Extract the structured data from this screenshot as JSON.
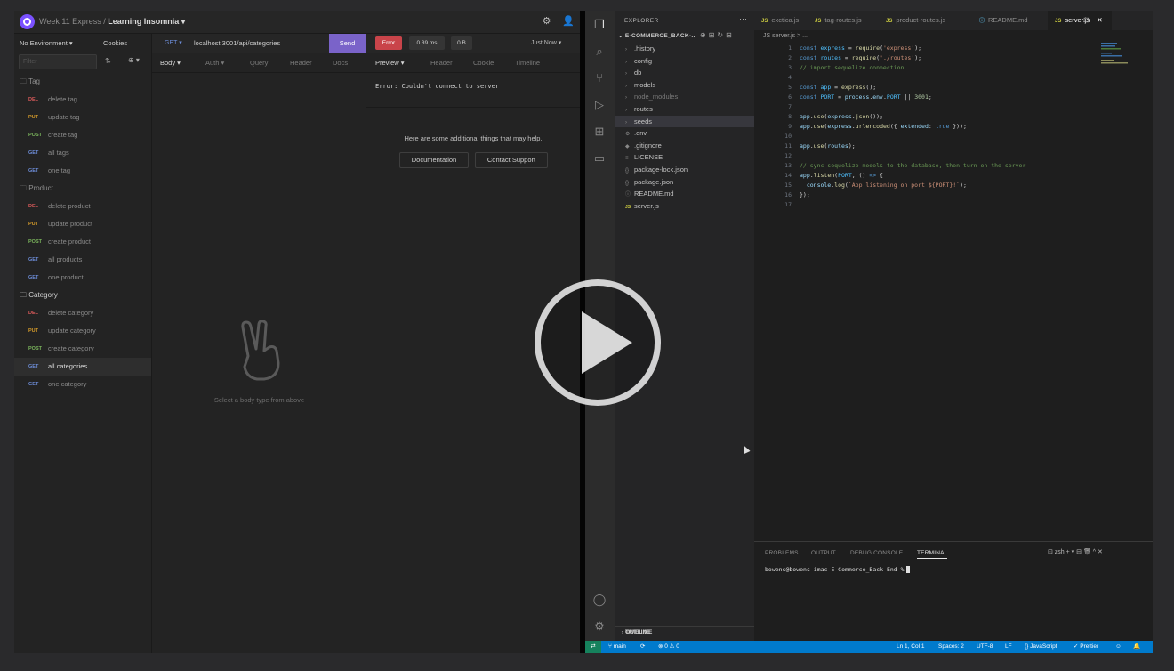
{
  "insomnia": {
    "title_prefix": "Week 11 Express / ",
    "title_main": "Learning Insomnia ▾",
    "environment": "No Environment ▾",
    "cookies": "Cookies",
    "filter_placeholder": "Filter",
    "folders": [
      {
        "name": "Tag",
        "requests": [
          {
            "method": "DEL",
            "name": "delete tag"
          },
          {
            "method": "PUT",
            "name": "update tag"
          },
          {
            "method": "POST",
            "name": "create tag"
          },
          {
            "method": "GET",
            "name": "all tags"
          },
          {
            "method": "GET",
            "name": "one tag"
          }
        ]
      },
      {
        "name": "Product",
        "requests": [
          {
            "method": "DEL",
            "name": "delete product"
          },
          {
            "method": "PUT",
            "name": "update product"
          },
          {
            "method": "POST",
            "name": "create product"
          },
          {
            "method": "GET",
            "name": "all products"
          },
          {
            "method": "GET",
            "name": "one product"
          }
        ]
      },
      {
        "name": "Category",
        "requests": [
          {
            "method": "DEL",
            "name": "delete category"
          },
          {
            "method": "PUT",
            "name": "update category"
          },
          {
            "method": "POST",
            "name": "create category"
          },
          {
            "method": "GET",
            "name": "all categories"
          },
          {
            "method": "GET",
            "name": "one category"
          }
        ]
      }
    ],
    "request": {
      "method": "GET ▾",
      "url": "localhost:3001/api/categories",
      "send": "Send"
    },
    "response": {
      "status": "Error",
      "time": "0.39 ms",
      "size": "0 B",
      "history": "Just Now ▾",
      "error_text": "Error: Couldn't connect to server",
      "help_text": "Here are some additional things that may help.",
      "btn_docs": "Documentation",
      "btn_support": "Contact Support"
    },
    "req_tabs": [
      "Body ▾",
      "Auth ▾",
      "Query",
      "Header",
      "Docs"
    ],
    "resp_tabs": [
      "Preview ▾",
      "Header",
      "Cookie",
      "Timeline"
    ],
    "body_hint": "Select a body type from above"
  },
  "vscode": {
    "explorer_title": "EXPLORER",
    "project": "E-COMMERCE_BACK-...",
    "files": [
      {
        "name": ".history",
        "type": "folder"
      },
      {
        "name": "config",
        "type": "folder"
      },
      {
        "name": "db",
        "type": "folder"
      },
      {
        "name": "models",
        "type": "folder"
      },
      {
        "name": "node_modules",
        "type": "folder",
        "dim": true
      },
      {
        "name": "routes",
        "type": "folder"
      },
      {
        "name": "seeds",
        "type": "folder",
        "selected": true
      },
      {
        "name": ".env",
        "type": "file",
        "icon": "⚙"
      },
      {
        "name": ".gitignore",
        "type": "file",
        "icon": "◆"
      },
      {
        "name": "LICENSE",
        "type": "file",
        "icon": "≡"
      },
      {
        "name": "package-lock.json",
        "type": "file",
        "icon": "{}"
      },
      {
        "name": "package.json",
        "type": "file",
        "icon": "{}"
      },
      {
        "name": "README.md",
        "type": "file",
        "icon": "ⓘ"
      },
      {
        "name": "server.js",
        "type": "file",
        "icon": "JS"
      }
    ],
    "tabs": [
      {
        "name": "exctica.js",
        "icon": "JS"
      },
      {
        "name": "tag-routes.js",
        "icon": "JS"
      },
      {
        "name": "product-routes.js",
        "icon": "JS"
      },
      {
        "name": "README.md",
        "icon": "ⓘ"
      },
      {
        "name": "server.js",
        "icon": "JS",
        "active": true
      }
    ],
    "breadcrumb": "JS server.js > ...",
    "outline": "OUTLINE",
    "timeline": "TIMELINE",
    "panel_tabs": [
      "PROBLEMS",
      "OUTPUT",
      "DEBUG CONSOLE",
      "TERMINAL"
    ],
    "panel_actions": "⊡ zsh  + ▾  ⊟  🗑  ^  ✕",
    "terminal_prompt": "bowens@bowens-imac E-Commerce_Back-End %",
    "status": {
      "branch": "main",
      "sync": "⟳",
      "errors": "⊗ 0 ⚠ 0",
      "position": "Ln 1, Col 1",
      "spaces": "Spaces: 2",
      "encoding": "UTF-8",
      "eol": "LF",
      "language": "{} JavaScript",
      "prettier": "✓ Prettier"
    }
  },
  "colors": {
    "accent": "#7a63c9",
    "error": "#c9444a",
    "statusbar": "#007acc",
    "del": "#d95a5a",
    "put": "#d49a2a",
    "post": "#7ab45c",
    "get": "#6d8dd8"
  }
}
